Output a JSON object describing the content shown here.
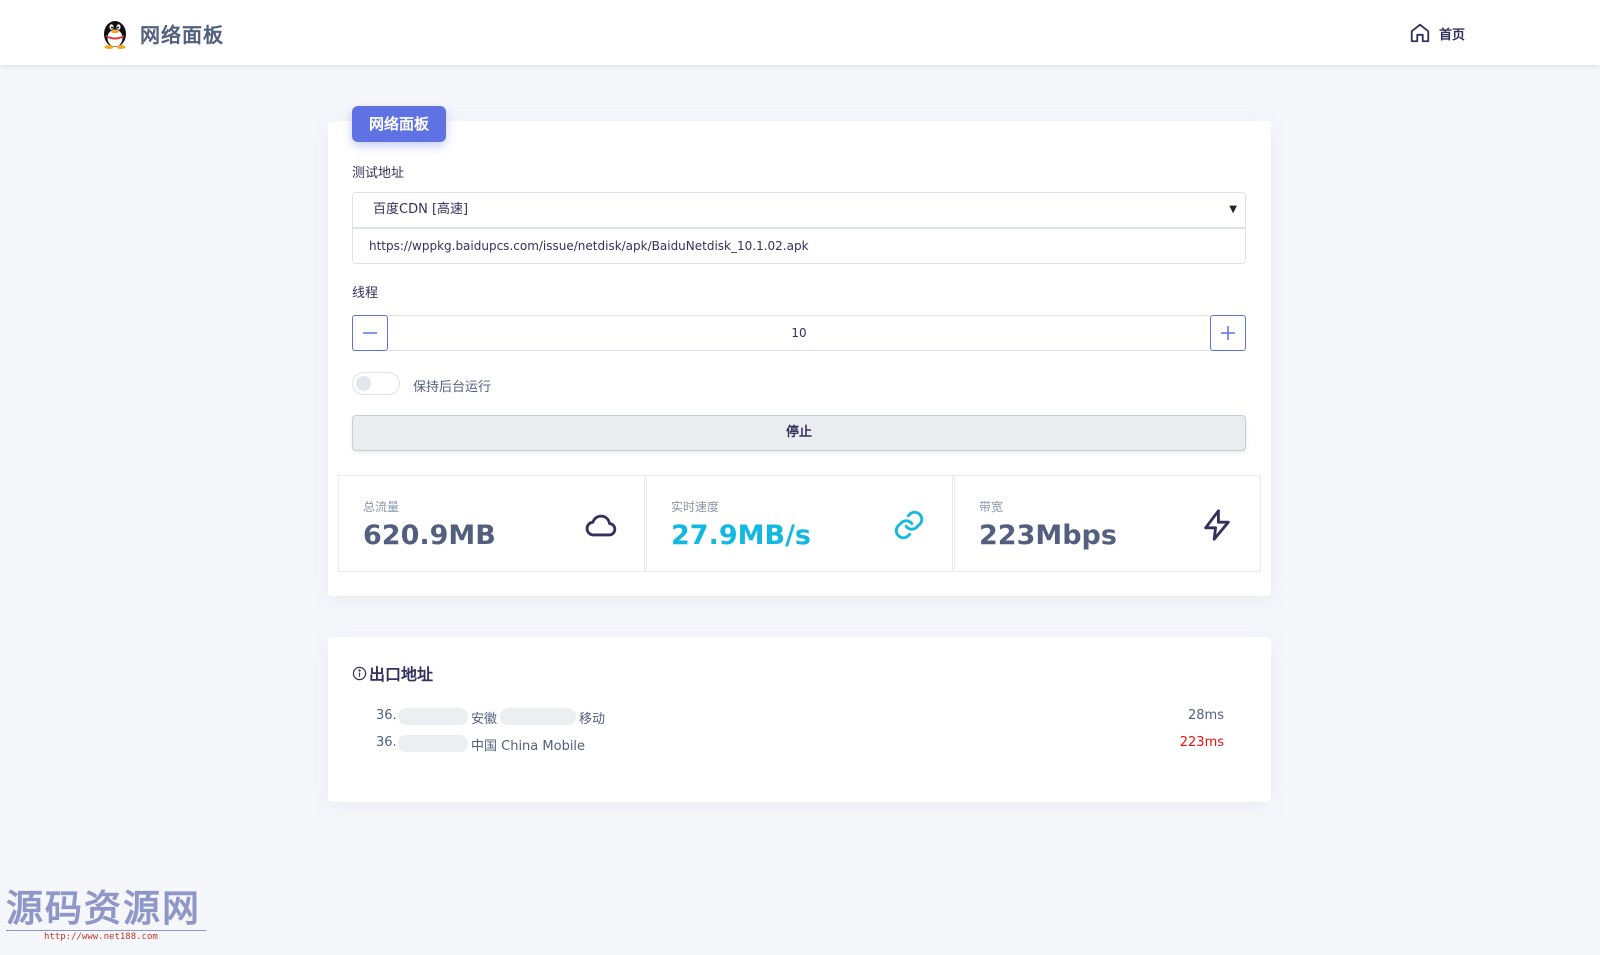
{
  "navbar": {
    "brand_title": "网络面板",
    "home_label": "首页"
  },
  "panel": {
    "tag": "网络面板",
    "test_address_label": "测试地址",
    "selected_source": "百度CDN [高速]",
    "url": "https://wppkg.baidupcs.com/issue/netdisk/apk/BaiduNetdisk_10.1.02.apk",
    "threads_label": "线程",
    "threads_value": "10",
    "keep_background_label": "保持后台运行",
    "keep_background_enabled": false,
    "stop_label": "停止"
  },
  "stats": [
    {
      "label": "总流量",
      "value": "620.9MB",
      "icon": "cloud-icon"
    },
    {
      "label": "实时速度",
      "value": "27.9MB/s",
      "icon": "link-icon"
    },
    {
      "label": "带宽",
      "value": "223Mbps",
      "icon": "lightning-icon"
    }
  ],
  "exit": {
    "title": "出口地址",
    "rows": [
      {
        "ip_prefix": "36.",
        "location": "安徽",
        "isp": "移动",
        "ping": "28ms"
      },
      {
        "ip_prefix": "36.",
        "location": "中国 China Mobile",
        "ping": "223ms"
      }
    ]
  },
  "watermark": {
    "title": "源码资源网",
    "url": "http://www.net188.com"
  },
  "colors": {
    "accent": "#5e72e4",
    "speed": "#11b8e0",
    "ping_bad": "#ee1111",
    "background": "#f6f7fb"
  }
}
